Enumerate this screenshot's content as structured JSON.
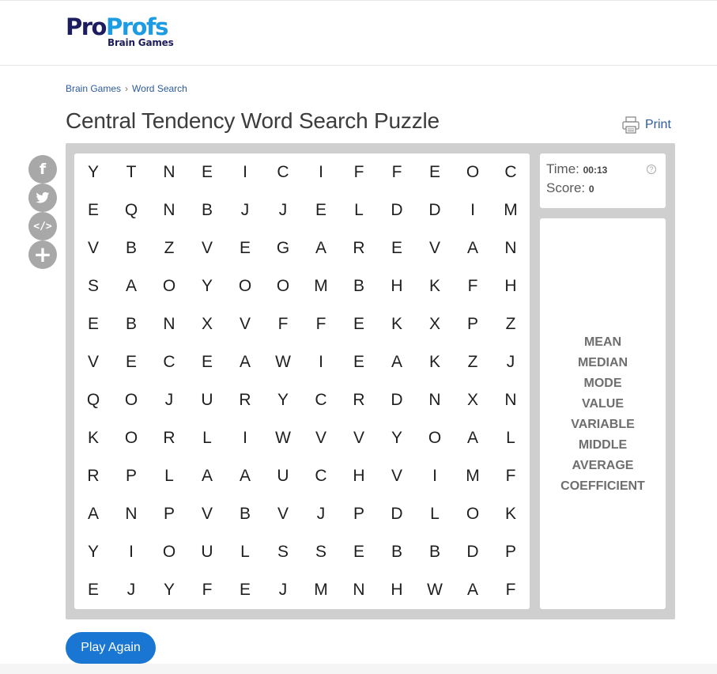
{
  "brand": {
    "name_part1": "Pro",
    "name_part2": "Profs",
    "subtitle": "Brain Games"
  },
  "breadcrumb": [
    "Brain Games",
    "Word Search"
  ],
  "breadcrumb_separator": "›",
  "title": "Central Tendency Word Search Puzzle",
  "print_label": "Print",
  "social": {
    "facebook_glyph": "f",
    "embed_glyph": "</>",
    "more_glyph": "+"
  },
  "stats": {
    "time_label": "Time:",
    "time_value": "00:13",
    "score_label": "Score:",
    "score_value": "0",
    "help_glyph": "?"
  },
  "grid": [
    [
      "Y",
      "T",
      "N",
      "E",
      "I",
      "C",
      "I",
      "F",
      "F",
      "E",
      "O",
      "C"
    ],
    [
      "E",
      "Q",
      "N",
      "B",
      "J",
      "J",
      "E",
      "L",
      "D",
      "D",
      "I",
      "M"
    ],
    [
      "V",
      "B",
      "Z",
      "V",
      "E",
      "G",
      "A",
      "R",
      "E",
      "V",
      "A",
      "N"
    ],
    [
      "S",
      "A",
      "O",
      "Y",
      "O",
      "O",
      "M",
      "B",
      "H",
      "K",
      "F",
      "H"
    ],
    [
      "E",
      "B",
      "N",
      "X",
      "V",
      "F",
      "F",
      "E",
      "K",
      "X",
      "P",
      "Z"
    ],
    [
      "V",
      "E",
      "C",
      "E",
      "A",
      "W",
      "I",
      "E",
      "A",
      "K",
      "Z",
      "J"
    ],
    [
      "Q",
      "O",
      "J",
      "U",
      "R",
      "Y",
      "C",
      "R",
      "D",
      "N",
      "X",
      "N"
    ],
    [
      "K",
      "O",
      "R",
      "L",
      "I",
      "W",
      "V",
      "V",
      "Y",
      "O",
      "A",
      "L"
    ],
    [
      "R",
      "P",
      "L",
      "A",
      "A",
      "U",
      "C",
      "H",
      "V",
      "I",
      "M",
      "F"
    ],
    [
      "A",
      "N",
      "P",
      "V",
      "B",
      "V",
      "J",
      "P",
      "D",
      "L",
      "O",
      "K"
    ],
    [
      "Y",
      "I",
      "O",
      "U",
      "L",
      "S",
      "S",
      "E",
      "B",
      "B",
      "D",
      "P"
    ],
    [
      "E",
      "J",
      "Y",
      "F",
      "E",
      "J",
      "M",
      "N",
      "H",
      "W",
      "A",
      "F"
    ]
  ],
  "words": [
    "MEAN",
    "MEDIAN",
    "MODE",
    "VALUE",
    "VARIABLE",
    "MIDDLE",
    "AVERAGE",
    "COEFFICIENT"
  ],
  "play_again_label": "Play Again",
  "colors": {
    "accent": "#1976d2",
    "link": "#2c5aa0",
    "board": "#cfcfcf",
    "brand_dark": "#1c1c5e",
    "brand_light": "#1d9be3"
  }
}
